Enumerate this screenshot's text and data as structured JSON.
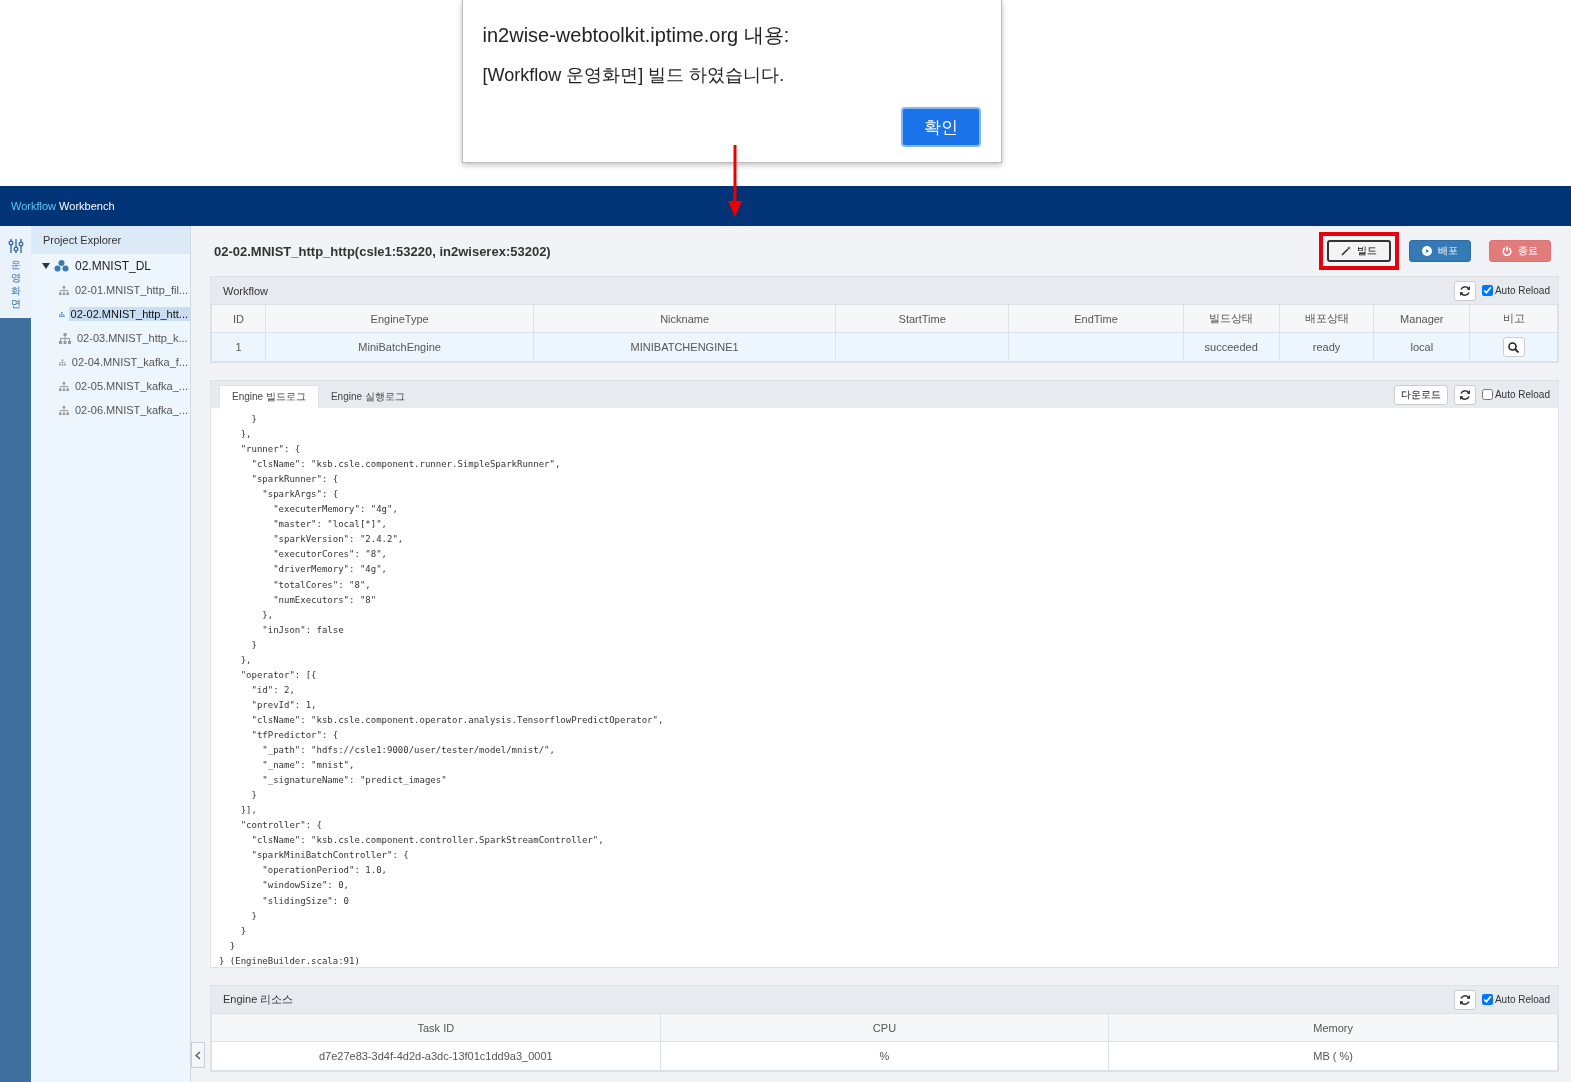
{
  "dialog": {
    "title": "in2wise-webtoolkit.iptime.org 내용:",
    "message": "[Workflow 운영화면] 빌드 하였습니다.",
    "button": "확인"
  },
  "app": {
    "brand_accent": "Workflow",
    "brand": "Workbench"
  },
  "side_strip": {
    "label": "운영화면",
    "selected": true
  },
  "sidebar": {
    "title": "Project Explorer",
    "tree": [
      {
        "label": "02.MNIST_DL",
        "expanded": true,
        "selected": false,
        "children": [
          {
            "label": "02-01.MNIST_http_fil...",
            "selected": false
          },
          {
            "label": "02-02.MNIST_http_htt...",
            "selected": true
          },
          {
            "label": "02-03.MNIST_http_k...",
            "selected": false
          },
          {
            "label": "02-04.MNIST_kafka_f...",
            "selected": false
          },
          {
            "label": "02-05.MNIST_kafka_...",
            "selected": false
          },
          {
            "label": "02-06.MNIST_kafka_...",
            "selected": false
          }
        ]
      }
    ]
  },
  "page_title": "02-02.MNIST_http_http(csle1:53220, in2wiserex:53202)",
  "actions": [
    {
      "label": "빌드",
      "kind": "default",
      "highlighted": true
    },
    {
      "label": "배포",
      "kind": "primary",
      "highlighted": false
    },
    {
      "label": "종료",
      "kind": "danger",
      "highlighted": false
    }
  ],
  "workflow": {
    "title": "Workflow",
    "auto_reload": {
      "label": "Auto Reload",
      "checked": true
    },
    "columns": [
      "ID",
      "EngineType",
      "Nickname",
      "StartTime",
      "EndTime",
      "빌드상태",
      "배포상태",
      "Manager",
      "비고"
    ],
    "rows": [
      [
        "1",
        "MiniBatchEngine",
        "MINIBATCHENGINE1",
        "",
        "",
        "succeeded",
        "ready",
        "local"
      ]
    ]
  },
  "logs": {
    "tabs": [
      {
        "label": "Engine 빌드로그",
        "selected": true
      },
      {
        "label": "Engine 실행로그",
        "selected": false
      }
    ],
    "download": "다운로드",
    "auto_reload": {
      "label": "Auto Reload",
      "checked": false
    },
    "lines": [
      "      }",
      "    },",
      "    \"runner\": {",
      "      \"clsName\": \"ksb.csle.component.runner.SimpleSparkRunner\",",
      "      \"sparkRunner\": {",
      "        \"sparkArgs\": {",
      "          \"executerMemory\": \"4g\",",
      "          \"master\": \"local[*]\",",
      "          \"sparkVersion\": \"2.4.2\",",
      "          \"executorCores\": \"8\",",
      "          \"driverMemory\": \"4g\",",
      "          \"totalCores\": \"8\",",
      "          \"numExecutors\": \"8\"",
      "        },",
      "        \"inJson\": false",
      "      }",
      "    },",
      "    \"operator\": [{",
      "      \"id\": 2,",
      "      \"prevId\": 1,",
      "      \"clsName\": \"ksb.csle.component.operator.analysis.TensorflowPredictOperator\",",
      "      \"tfPredictor\": {",
      "        \"_path\": \"hdfs://csle1:9000/user/tester/model/mnist/\",",
      "        \"_name\": \"mnist\",",
      "        \"_signatureName\": \"predict_images\"",
      "      }",
      "    }],",
      "    \"controller\": {",
      "      \"clsName\": \"ksb.csle.component.controller.SparkStreamController\",",
      "      \"sparkMiniBatchController\": {",
      "        \"operationPeriod\": 1.0,",
      "        \"windowSize\": 0,",
      "        \"slidingSize\": 0",
      "      }",
      "    }",
      "  }",
      "} (EngineBuilder.scala:91)"
    ]
  },
  "resources": {
    "title": "Engine 리소스",
    "auto_reload": {
      "label": "Auto Reload",
      "checked": true
    },
    "columns": [
      "Task ID",
      "CPU",
      "Memory"
    ],
    "rows": [
      [
        "d7e27e83-3d4f-4d2d-a3dc-13f01c1dd9a3_0001",
        "%",
        "MB ( %)"
      ]
    ]
  }
}
